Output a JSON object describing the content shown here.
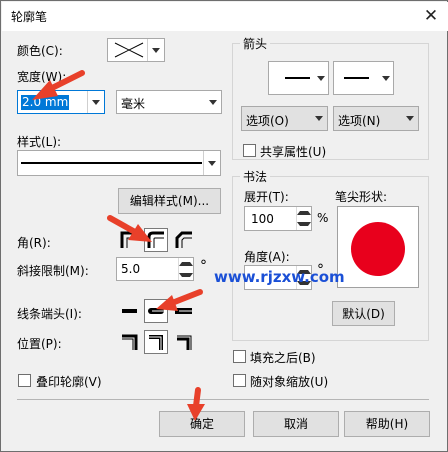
{
  "window": {
    "title": "轮廓笔",
    "close_glyph": "✕"
  },
  "left": {
    "color_label": "颜色(C):",
    "width_label": "宽度(W):",
    "width_value": "2.0 mm",
    "unit_value": "毫米",
    "style_label": "样式(L):",
    "edit_style_button": "编辑样式(M)...",
    "corner_label": "角(R):",
    "miter_label": "斜接限制(M):",
    "miter_value": "5.0",
    "miter_unit": "°",
    "line_cap_label": "线条端头(I):",
    "position_label": "位置(P):",
    "overprint_label": "叠印轮廓(V)"
  },
  "arrows": {
    "group_title": "箭头",
    "options_left": "选项(O)",
    "options_right": "选项(N)",
    "share_label": "共享属性(U)"
  },
  "calligraphy": {
    "group_title": "书法",
    "stretch_label": "展开(T):",
    "stretch_value": "100",
    "stretch_unit": "%",
    "nib_label": "笔尖形状:",
    "angle_label": "角度(A):",
    "angle_value": "",
    "angle_unit": "°",
    "default_button": "默认(D)",
    "nib_color": "#e8001c"
  },
  "bottom": {
    "fill_behind_label": "填充之后(B)",
    "scale_label": "随对象缩放(U)",
    "ok": "确定",
    "cancel": "取消",
    "help": "帮助(H)"
  },
  "watermark": "www.rjzxw.com",
  "colors": {
    "accent": "#0078d7",
    "annotation_red": "#e8402a",
    "watermark": "#1a4fd6"
  }
}
